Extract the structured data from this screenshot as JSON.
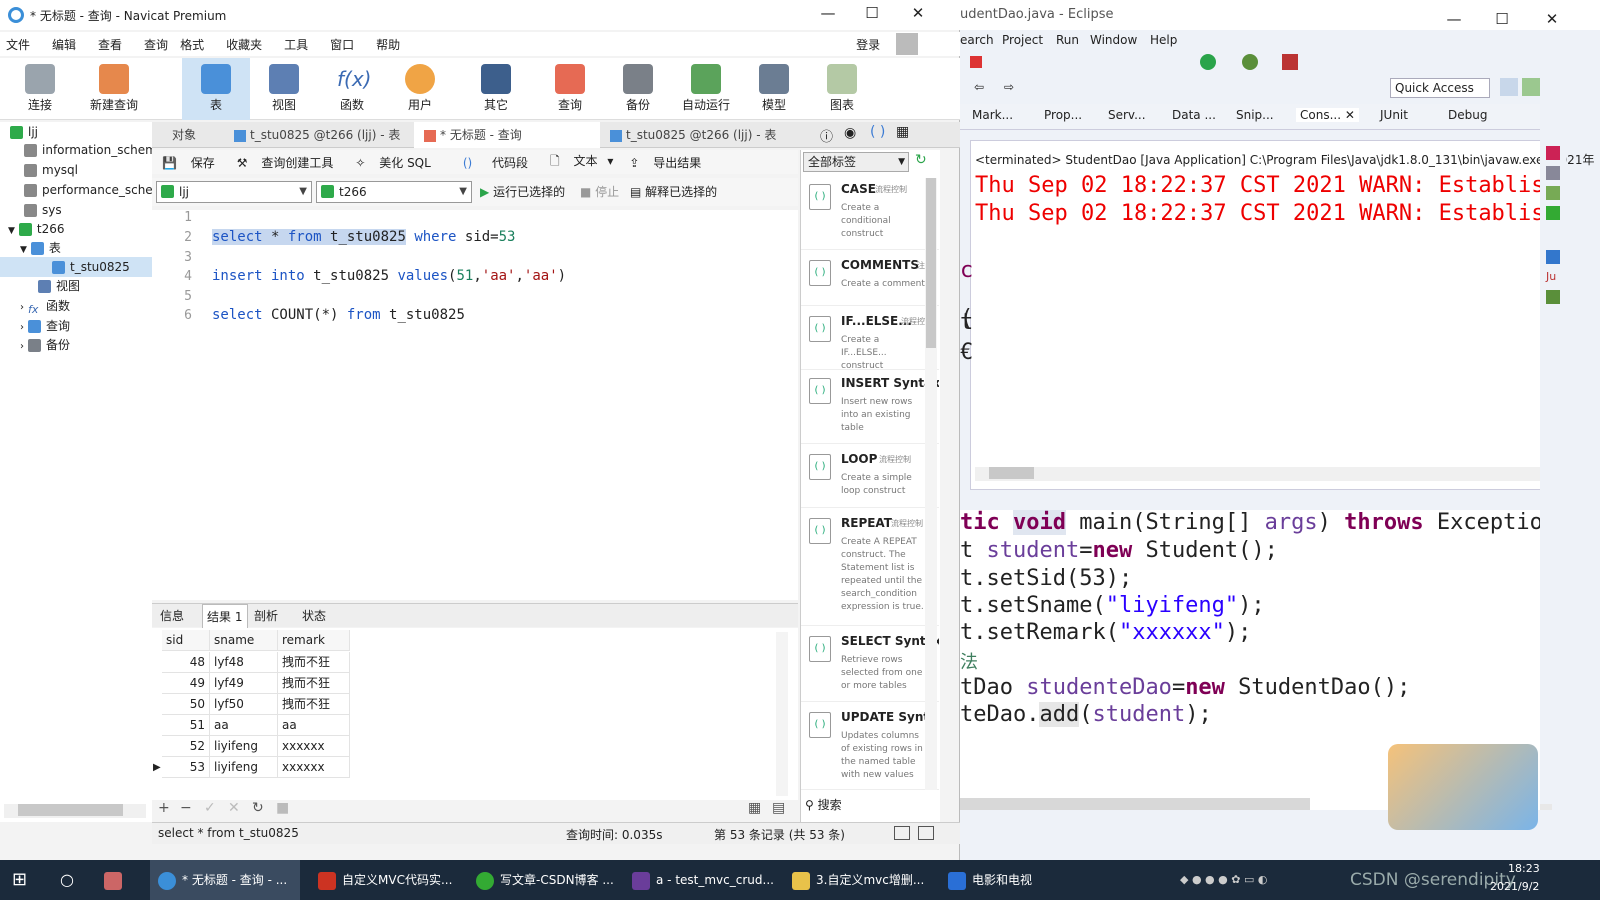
{
  "navicat": {
    "title": "* 无标题 - 查询 - Navicat Premium",
    "menu": [
      "文件",
      "编辑",
      "查看",
      "查询",
      "格式",
      "收藏夹",
      "工具",
      "窗口",
      "帮助"
    ],
    "login": "登录",
    "toolbar": [
      "连接",
      "新建查询",
      "表",
      "视图",
      "函数",
      "用户",
      "其它",
      "查询",
      "备份",
      "自动运行",
      "模型",
      "图表"
    ],
    "tree": [
      {
        "label": "ljj"
      },
      {
        "label": "information_schem"
      },
      {
        "label": "mysql"
      },
      {
        "label": "performance_sche"
      },
      {
        "label": "sys"
      },
      {
        "label": "t266"
      },
      {
        "label": "表"
      },
      {
        "label": "t_stu0825"
      },
      {
        "label": "视图"
      },
      {
        "label": "函数"
      },
      {
        "label": "查询"
      },
      {
        "label": "备份"
      }
    ],
    "tabs": [
      "对象",
      "t_stu0825 @t266 (ljj) - 表",
      "* 无标题 - 查询",
      "t_stu0825 @t266 (ljj) - 表"
    ],
    "editor_toolbar": [
      "保存",
      "查询创建工具",
      "美化 SQL",
      "代码段",
      "文本",
      "导出结果"
    ],
    "connection": "ljj",
    "database": "t266",
    "run_label": "运行已选择的",
    "stop_label": "停止",
    "explain_label": "解释已选择的",
    "line_numbers": [
      "1",
      "2",
      "3",
      "4",
      "5",
      "6"
    ],
    "code": {
      "l2_kw1": "select",
      "l2_a": " * ",
      "l2_kw2": "from",
      "l2_b": " t_stu0825",
      "l2_kw3": " where",
      "l2_c": " sid=",
      "l2_n": "53",
      "l4_kw1": "insert",
      "l4_kw2": " into",
      "l4_a": " t_stu0825 ",
      "l4_kw3": "values",
      "l4_b": "(",
      "l4_n": "51",
      "l4_c": ",",
      "l4_s1": "'aa'",
      "l4_d": ",",
      "l4_s2": "'aa'",
      "l4_e": ")",
      "l6_kw1": "select",
      "l6_a": " COUNT(*) ",
      "l6_kw2": "from",
      "l6_b": " t_stu0825"
    },
    "result_tabs": [
      "信息",
      "结果 1",
      "剖析",
      "状态"
    ],
    "grid": {
      "headers": [
        "sid",
        "sname",
        "remark"
      ],
      "rows": [
        [
          "48",
          "lyf48",
          "拽而不狂"
        ],
        [
          "49",
          "lyf49",
          "拽而不狂"
        ],
        [
          "50",
          "lyf50",
          "拽而不狂"
        ],
        [
          "51",
          "aa",
          "aa"
        ],
        [
          "52",
          "liyifeng",
          "xxxxxx"
        ],
        [
          "53",
          "liyifeng",
          "xxxxxx"
        ]
      ]
    },
    "status": {
      "sql": "select * from t_stu0825",
      "time": "查询时间: 0.035s",
      "records": "第 53 条记录 (共 53 条)"
    },
    "snippet_filter": "全部标签",
    "snippet_search": "搜索",
    "snippets": [
      {
        "name": "CASE",
        "cat": "流程控制",
        "desc": "Create a conditional construct"
      },
      {
        "name": "COMMENTS",
        "cat": "注",
        "desc": "Create a comment"
      },
      {
        "name": "IF...ELSE...",
        "cat": "流程控",
        "desc": "Create a IF...ELSE... construct"
      },
      {
        "name": "INSERT Syntax",
        "cat": "",
        "desc": "Insert new rows into an existing table"
      },
      {
        "name": "LOOP",
        "cat": "流程控制",
        "desc": "Create a simple loop construct"
      },
      {
        "name": "REPEAT",
        "cat": "流程控制",
        "desc": "Create A REPEAT construct. The Statement list is repeated until the search_condition expression is true."
      },
      {
        "name": "SELECT Syntax",
        "cat": "",
        "desc": "Retrieve rows selected from one or more tables"
      },
      {
        "name": "UPDATE Synta",
        "cat": "",
        "desc": "Updates columns of existing rows in the named table with new values"
      }
    ]
  },
  "eclipse": {
    "title": "udentDao.java - Eclipse",
    "menu": [
      "earch",
      "Project",
      "Run",
      "Window",
      "Help"
    ],
    "quick_access": "Quick Access",
    "tabs": [
      "Mark...",
      "Prop...",
      "Serv...",
      "Data ...",
      "Snip...",
      "Cons...",
      "JUnit",
      "Debug"
    ],
    "console_header": "<terminated> StudentDao [Java Application] C:\\Program Files\\Java\\jdk1.8.0_131\\bin\\javaw.exe (2021年",
    "console_lines": [
      "Thu Sep 02 18:22:37 CST 2021 WARN: Establish",
      "Thu Sep 02 18:22:37 CST 2021 WARN: Establish"
    ],
    "gutter_chars": [
      "c",
      "(",
      "t",
      "€"
    ],
    "source": {
      "s1_a": "tic ",
      "s1_kw1": "void",
      "s1_b": " main(String[] ",
      "s1_v": "args",
      "s1_c": ") ",
      "s1_kw2": "throws",
      "s1_d": " Exceptio",
      "s2_a": "t ",
      "s2_v": "student",
      "s2_b": "=",
      "s2_kw": "new",
      "s2_c": " Student();",
      "s3_a": "t.setSid(53);",
      "s4_a": "t.setSname(",
      "s4_s": "\"liyifeng\"",
      "s4_b": ");",
      "s5_a": "t.setRemark(",
      "s5_s": "\"xxxxxx\"",
      "s5_b": ");",
      "s6_a": "法",
      "s7_a": "tDao ",
      "s7_v": "studenteDao",
      "s7_b": "=",
      "s7_kw": "new",
      "s7_c": " StudentDao();",
      "s8_a": "teDao.",
      "s8_b": "add",
      "s8_c": "(",
      "s8_v": "student",
      "s8_d": ");"
    }
  },
  "taskbar": {
    "items": [
      "* 无标题 - 查询 - ...",
      "自定义MVC代码实...",
      "写文章-CSDN博客 ...",
      "a - test_mvc_crud...",
      "3.自定义mvc增删...",
      "电影和电视"
    ],
    "watermark": "CSDN @serendipity",
    "time": "18:23",
    "date": "2021/9/2"
  }
}
